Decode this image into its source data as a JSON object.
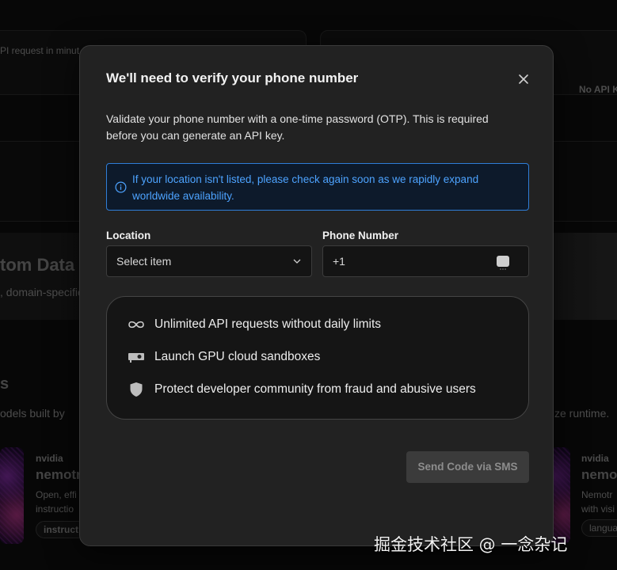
{
  "background": {
    "api_request_text": "PI request in minut",
    "no_api_key_text": "No API K",
    "banner_title": "tom Data",
    "banner_subtitle": ", domain-specific",
    "section_heading": "s",
    "section_subtitle_left": "odels built by",
    "section_subtitle_right": "ze runtime.",
    "cards": [
      {
        "vendor": "nvidia",
        "name": "nemotr",
        "desc_line1": "Open, effi",
        "desc_line2": "instructio",
        "chip": "instruct"
      },
      {
        "vendor": "nvidia",
        "name": "nemot",
        "desc_line1": "Nemotr",
        "desc_line2": "with visi",
        "chip": "langua"
      }
    ]
  },
  "modal": {
    "title": "We'll need to verify your phone number",
    "description": "Validate your phone number with a one-time password (OTP). This is required before you can generate an API key.",
    "info_text": "If your location isn't listed, please check again soon as we rapidly expand worldwide availability.",
    "location_label": "Location",
    "location_placeholder": "Select item",
    "phone_label": "Phone Number",
    "phone_prefix": "+1",
    "features": [
      {
        "icon": "infinity-icon",
        "text": "Unlimited API requests without daily limits"
      },
      {
        "icon": "gpu-card-icon",
        "text": "Launch GPU cloud sandboxes"
      },
      {
        "icon": "shield-icon",
        "text": "Protect developer community from fraud and abusive users"
      }
    ],
    "send_button": "Send Code via SMS",
    "accent_color": "#2f7ed8"
  },
  "watermark": "掘金技术社区 @ 一念杂记"
}
